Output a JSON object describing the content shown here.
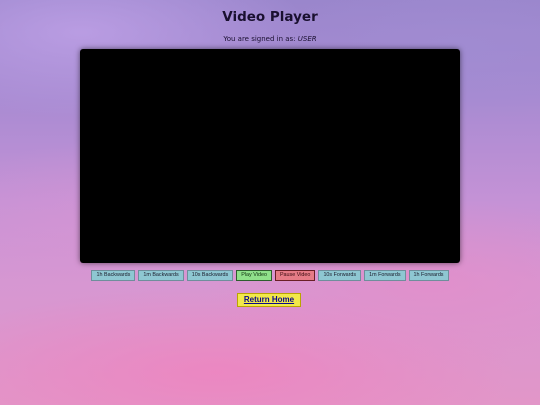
{
  "page": {
    "title": "Video Player",
    "signed_in_prefix": "You are signed in as:",
    "user": "USER"
  },
  "controls": [
    {
      "label": "1h Backwards"
    },
    {
      "label": "1m Backwards"
    },
    {
      "label": "10s Backwards"
    },
    {
      "label": "Play Video"
    },
    {
      "label": "Pause Video"
    },
    {
      "label": "10s Forwards"
    },
    {
      "label": "1m Forwards"
    },
    {
      "label": "1h Forwards"
    }
  ],
  "footer": {
    "return_home_label": "Return Home"
  },
  "colors": {
    "seek_button": "#8ec7d2",
    "play_button": "#8fe08a",
    "pause_button": "#e67b86",
    "home_button": "#f2e84a",
    "video_area": "#000000"
  }
}
